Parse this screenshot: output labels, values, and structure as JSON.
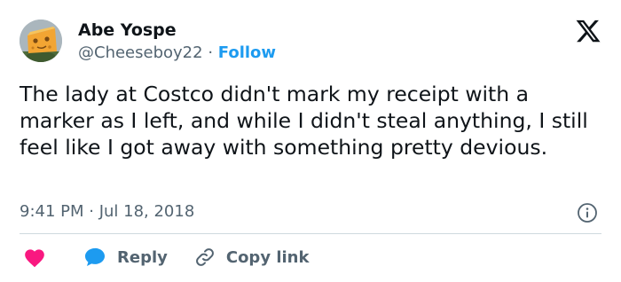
{
  "author": {
    "name": "Abe Yospe",
    "handle": "@Cheeseboy22",
    "separator": "·",
    "follow_label": "Follow",
    "avatar": "cheese-head-avatar"
  },
  "tweet": {
    "text": "The lady at Costco didn't mark my receipt with a marker as I left, and while I didn't steal anything, I still feel like I got away with something pretty devious.",
    "timestamp": "9:41 PM · Jul 18, 2018"
  },
  "actions": {
    "like_icon": "heart-icon",
    "reply_label": "Reply",
    "copy_link_label": "Copy link"
  },
  "icons": {
    "logo": "x-logo-icon",
    "info": "info-icon"
  },
  "colors": {
    "text": "#0f1419",
    "secondary": "#536471",
    "link": "#1d9bf0",
    "heart": "#f91880",
    "divider": "#cfd9de"
  }
}
